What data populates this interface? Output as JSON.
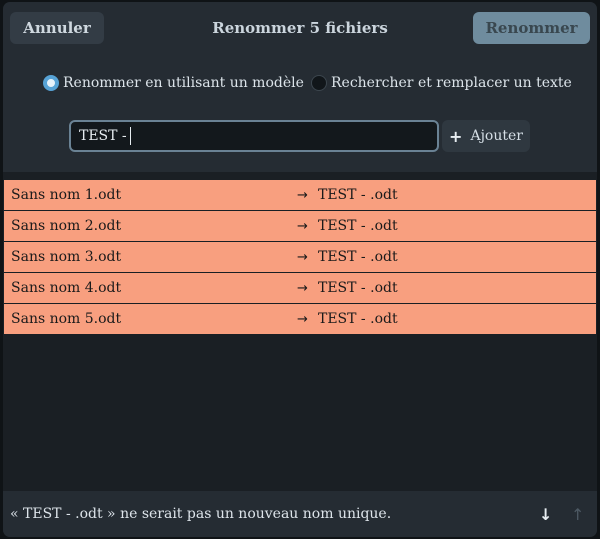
{
  "header": {
    "cancel_label": "Annuler",
    "title": "Renommer 5 fichiers",
    "rename_label": "Renommer"
  },
  "mode": {
    "options": [
      {
        "label": "Renommer en utilisant un modèle",
        "selected": true
      },
      {
        "label": "Rechercher et remplacer un texte",
        "selected": false
      }
    ]
  },
  "template_input": {
    "value": "TEST -"
  },
  "add_button": {
    "icon": "plus-icon",
    "label": "Ajouter"
  },
  "files": [
    {
      "old": "Sans nom 1.odt",
      "new": "TEST - .odt"
    },
    {
      "old": "Sans nom 2.odt",
      "new": "TEST - .odt"
    },
    {
      "old": "Sans nom 3.odt",
      "new": "TEST - .odt"
    },
    {
      "old": "Sans nom 4.odt",
      "new": "TEST - .odt"
    },
    {
      "old": "Sans nom 5.odt",
      "new": "TEST - .odt"
    }
  ],
  "arrow_glyph": "→",
  "footer": {
    "message": "« TEST - .odt » ne serait pas un nouveau nom unique.",
    "down_icon": "arrow-down-icon",
    "up_icon": "arrow-up-icon"
  },
  "colors": {
    "conflict_row": "#f89f7f",
    "accent": "#57a3d6",
    "suggested_button": "#6f8c9e"
  }
}
